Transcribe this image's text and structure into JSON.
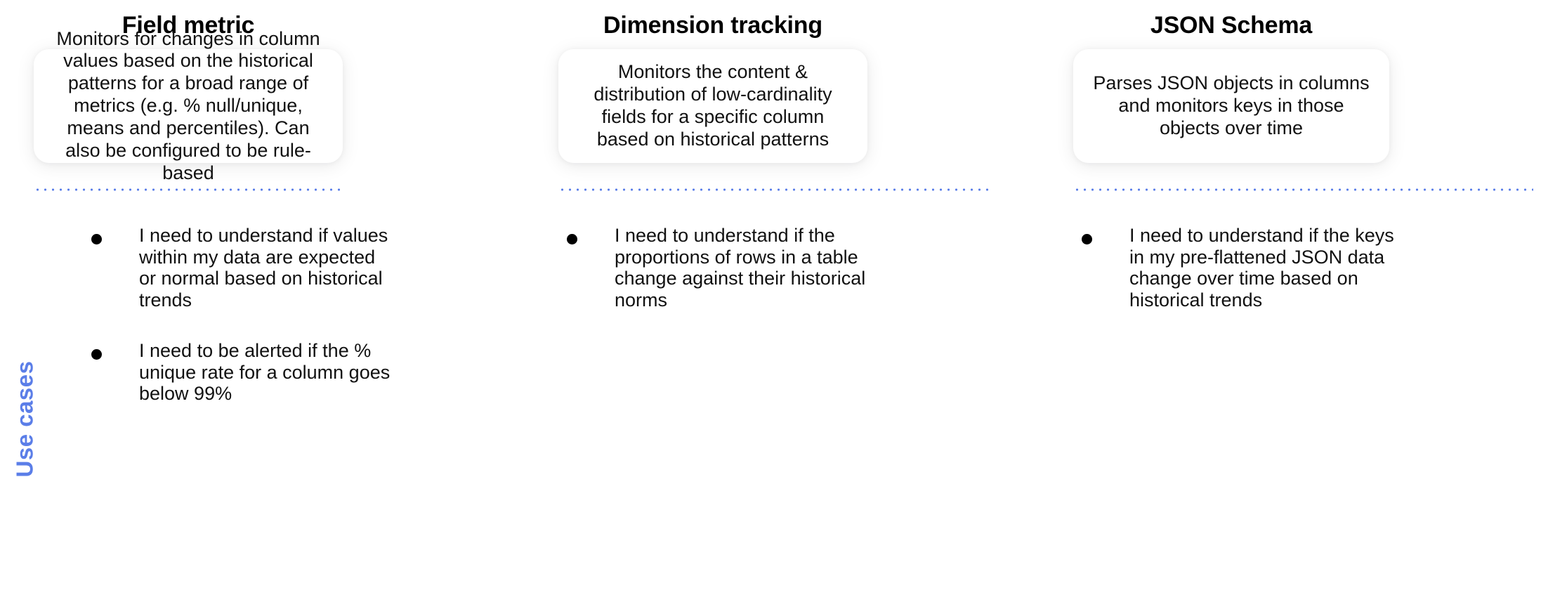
{
  "slide": {
    "background_color": "#ffffff",
    "accent_color": "#5b7ee8",
    "text_color": "#111111"
  },
  "side_label": {
    "text": "Use cases",
    "color": "#5b7ee8",
    "orientation": "vertical-rotated-90"
  },
  "columns": [
    {
      "title": "Field metric",
      "card_text": "Monitors for changes in column values based on the historical patterns for a broad range of metrics (e.g. % null/unique, means and percentiles). Can also be configured to be rule-based",
      "use_cases": [
        "I need to understand if values within my data are expected or normal based on historical trends",
        "I need to be alerted if the % unique rate for a column goes below 99%"
      ]
    },
    {
      "title": "Dimension tracking",
      "card_text": "Monitors the content & distribution of low-cardinality fields for a specific column based on historical patterns",
      "use_cases": [
        "I need to understand if the proportions of rows in a table change against their historical norms"
      ]
    },
    {
      "title": "JSON Schema",
      "card_text": "Parses JSON objects in columns and monitors keys in those objects over time",
      "use_cases": [
        "I need to understand if the keys in my pre-flattened JSON data change over time based on historical trends"
      ]
    }
  ]
}
